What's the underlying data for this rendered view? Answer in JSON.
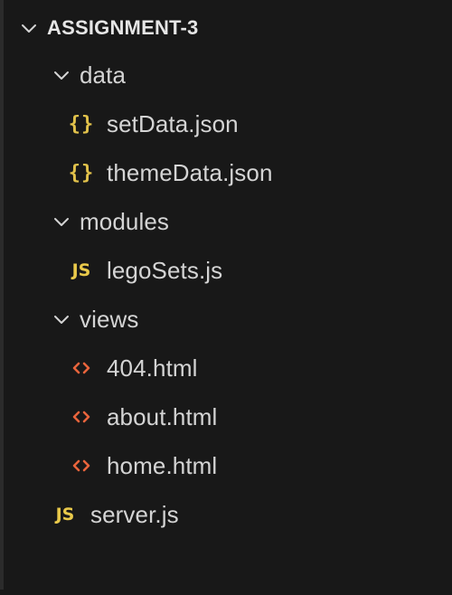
{
  "explorer": {
    "root": {
      "label": "ASSIGNMENT-3",
      "chevron_icon": "chevron-down-icon"
    },
    "folders": {
      "data": {
        "label": "data",
        "files": [
          {
            "label": "setData.json",
            "icon": "json-icon",
            "icon_text": "{}"
          },
          {
            "label": "themeData.json",
            "icon": "json-icon",
            "icon_text": "{}"
          }
        ]
      },
      "modules": {
        "label": "modules",
        "files": [
          {
            "label": "legoSets.js",
            "icon": "js-icon",
            "icon_text": "JS"
          }
        ]
      },
      "views": {
        "label": "views",
        "files": [
          {
            "label": "404.html",
            "icon": "html-icon"
          },
          {
            "label": "about.html",
            "icon": "html-icon"
          },
          {
            "label": "home.html",
            "icon": "html-icon"
          }
        ]
      }
    },
    "root_files": [
      {
        "label": "server.js",
        "icon": "js-icon",
        "icon_text": "JS"
      }
    ],
    "colors": {
      "background": "#181818",
      "json_icon": "#e2c24b",
      "js_icon": "#e9c94a",
      "html_icon": "#e8643c",
      "text": "#d4d4d4"
    }
  }
}
